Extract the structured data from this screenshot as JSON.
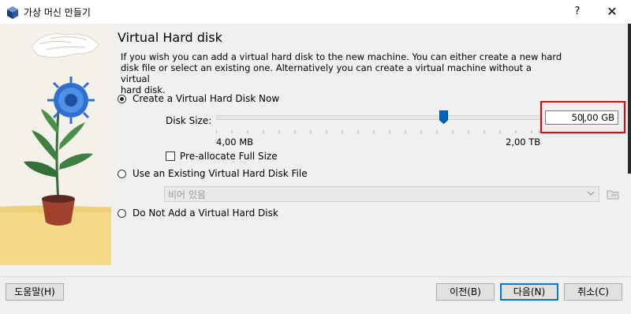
{
  "window": {
    "title": "가상 머신 만들기",
    "help_label": "?",
    "close_label": "✕",
    "app_icon": "virtualbox-cube-icon"
  },
  "page": {
    "heading": "Virtual Hard disk",
    "description_lines": [
      "If you wish you can add a virtual hard disk to the new machine. You can either create a new hard",
      "disk file or select an existing one. Alternatively you can create a virtual machine without a virtual",
      "hard disk."
    ]
  },
  "options": {
    "create_new": {
      "label": "Create a Virtual Hard Disk Now",
      "selected": true
    },
    "use_existing": {
      "label": "Use an Existing Virtual Hard Disk File",
      "selected": false
    },
    "no_disk": {
      "label": "Do Not Add a Virtual Hard Disk",
      "selected": false
    }
  },
  "disk_size": {
    "label": "Disk Size:",
    "min_label": "4,00 MB",
    "max_label": "2,00 TB",
    "slider_fraction": 0.7,
    "value_before_cursor": "50",
    "value_after_cursor": ",00 GB"
  },
  "preallocate": {
    "label": "Pre-allocate Full Size",
    "checked": false
  },
  "existing_file": {
    "placeholder": "비어 있음",
    "arrow_icon": "chevron-down-icon",
    "folder_icon": "folder-open-icon"
  },
  "footer": {
    "help": "도움말(H)",
    "back": "이전(B)",
    "next": "다음(N)",
    "cancel": "취소(C)"
  },
  "colors": {
    "highlight": "#ee0000",
    "slider_thumb": "#0063c6",
    "default_button_border": "#0078d7",
    "panel_background": "#f0f0f0"
  }
}
